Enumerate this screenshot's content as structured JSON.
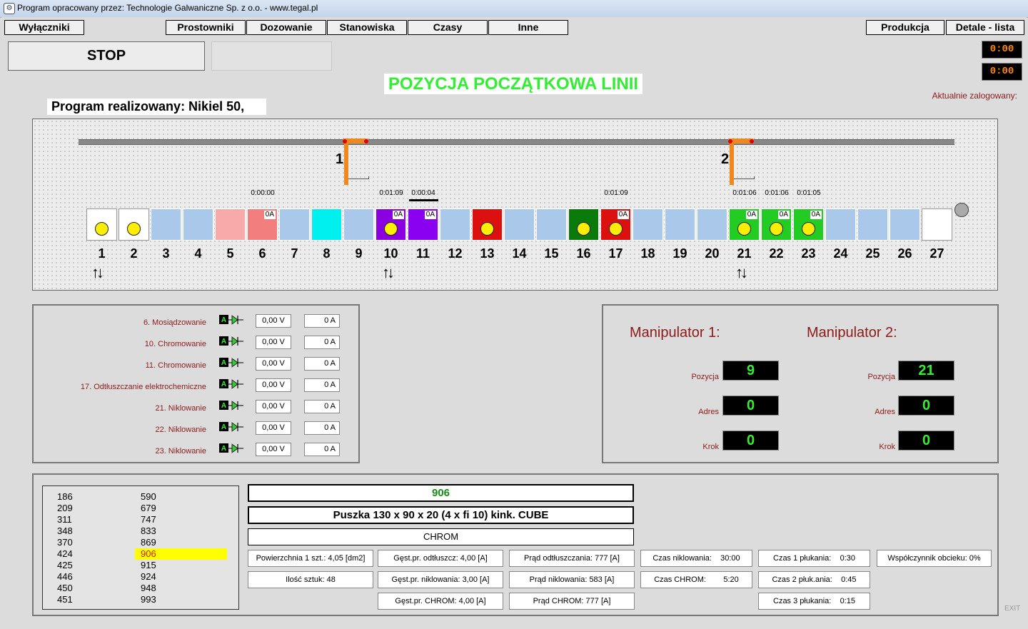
{
  "window": {
    "title": "Program opracowany przez: Technologie Galwaniczne Sp. z o.o. - www.tegal.pl"
  },
  "toolbar": {
    "wylaczniki": "Wyłączniki",
    "prostowniki": "Prostowniki",
    "dozowanie": "Dozowanie",
    "stanowiska": "Stanowiska",
    "czasy": "Czasy",
    "inne": "Inne",
    "produkcja": "Produkcja",
    "detale": "Detale - lista"
  },
  "status": {
    "stop": "STOP",
    "clock1": "0:00",
    "clock2": "0:00",
    "position_label": "POZYCJA POCZĄTKOWA LINII",
    "logged_in": "Aktualnie zalogowany:",
    "program": "Program realizowany: Nikiel 50,"
  },
  "line": {
    "crane1": "1",
    "crane2": "2",
    "tanks": [
      {
        "num": "1",
        "color": "#ffffff",
        "ball": true,
        "amp": "",
        "time": ""
      },
      {
        "num": "2",
        "color": "#ffffff",
        "ball": true,
        "amp": "",
        "time": ""
      },
      {
        "num": "3",
        "color": "#aac8ea",
        "ball": false,
        "amp": "",
        "time": ""
      },
      {
        "num": "4",
        "color": "#aac8ea",
        "ball": false,
        "amp": "",
        "time": ""
      },
      {
        "num": "5",
        "color": "#f8aaaa",
        "ball": false,
        "amp": "",
        "time": ""
      },
      {
        "num": "6",
        "color": "#f27e7e",
        "ball": false,
        "amp": "0A",
        "time": "0:00:00"
      },
      {
        "num": "7",
        "color": "#aac8ea",
        "ball": false,
        "amp": "",
        "time": ""
      },
      {
        "num": "8",
        "color": "#00f0f0",
        "ball": false,
        "amp": "",
        "time": ""
      },
      {
        "num": "9",
        "color": "#aac8ea",
        "ball": false,
        "amp": "",
        "time": ""
      },
      {
        "num": "10",
        "color": "#8a00e0",
        "ball": true,
        "amp": "0A",
        "time": "0:01:09"
      },
      {
        "num": "11",
        "color": "#8a00f0",
        "ball": false,
        "amp": "0A",
        "time": "0:00:04"
      },
      {
        "num": "12",
        "color": "#aac8ea",
        "ball": false,
        "amp": "",
        "time": ""
      },
      {
        "num": "13",
        "color": "#dd1010",
        "ball": true,
        "amp": "",
        "time": ""
      },
      {
        "num": "14",
        "color": "#aac8ea",
        "ball": false,
        "amp": "",
        "time": ""
      },
      {
        "num": "15",
        "color": "#aac8ea",
        "ball": false,
        "amp": "",
        "time": ""
      },
      {
        "num": "16",
        "color": "#0a7a0a",
        "ball": true,
        "amp": "",
        "time": ""
      },
      {
        "num": "17",
        "color": "#dd1010",
        "ball": true,
        "amp": "0A",
        "time": "0:01:09"
      },
      {
        "num": "18",
        "color": "#aac8ea",
        "ball": false,
        "amp": "",
        "time": ""
      },
      {
        "num": "19",
        "color": "#aac8ea",
        "ball": false,
        "amp": "",
        "time": ""
      },
      {
        "num": "20",
        "color": "#aac8ea",
        "ball": false,
        "amp": "",
        "time": ""
      },
      {
        "num": "21",
        "color": "#22cc22",
        "ball": true,
        "amp": "0A",
        "time": "0:01:06"
      },
      {
        "num": "22",
        "color": "#22cc22",
        "ball": true,
        "amp": "0A",
        "time": "0:01:06"
      },
      {
        "num": "23",
        "color": "#22cc22",
        "ball": true,
        "amp": "0A",
        "time": "0:01:05"
      },
      {
        "num": "24",
        "color": "#aac8ea",
        "ball": false,
        "amp": "",
        "time": ""
      },
      {
        "num": "25",
        "color": "#aac8ea",
        "ball": false,
        "amp": "",
        "time": ""
      },
      {
        "num": "26",
        "color": "#aac8ea",
        "ball": false,
        "amp": "",
        "time": ""
      },
      {
        "num": "27",
        "color": "#ffffff",
        "ball": false,
        "amp": "",
        "time": ""
      }
    ]
  },
  "rectifiers": [
    {
      "label": "6. Mosiądzowanie",
      "voltage": "0,00 V",
      "current": "0 A"
    },
    {
      "label": "10. Chromowanie",
      "voltage": "0,00 V",
      "current": "0 A"
    },
    {
      "label": "11. Chromowanie",
      "voltage": "0,00 V",
      "current": "0 A"
    },
    {
      "label": "17. Odtłuszczanie elektrochemiczne",
      "voltage": "0,00 V",
      "current": "0 A"
    },
    {
      "label": "21. Niklowanie",
      "voltage": "0,00 V",
      "current": "0 A"
    },
    {
      "label": "22. Niklowanie",
      "voltage": "0,00 V",
      "current": "0 A"
    },
    {
      "label": "23. Niklowanie",
      "voltage": "0,00 V",
      "current": "0 A"
    }
  ],
  "manipulators": {
    "m1": {
      "title": "Manipulator 1:",
      "pozycja_label": "Pozycja",
      "pozycja": "9",
      "adres_label": "Adres",
      "adres": "0",
      "krok_label": "Krok",
      "krok": "0"
    },
    "m2": {
      "title": "Manipulator 2:",
      "pozycja_label": "Pozycja",
      "pozycja": "21",
      "adres_label": "Adres",
      "adres": "0",
      "krok_label": "Krok",
      "krok": "0"
    }
  },
  "detail_list": {
    "col1": [
      "186",
      "209",
      "311",
      "348",
      "370",
      "424",
      "425",
      "446",
      "450",
      "451"
    ],
    "col2": [
      "590",
      "679",
      "747",
      "833",
      "869",
      "906",
      "915",
      "924",
      "948",
      "993"
    ],
    "selected": "906"
  },
  "detail": {
    "number": "906",
    "name": "Puszka 130 x 90 x 20 (4 x fi  10) kink. CUBE",
    "process": "CHROM",
    "powierzchnia": "Powierzchnia 1 szt.: 4,05 [dm2]",
    "ilosc": "Ilość sztuk: 48",
    "gest_odtl": "Gęst.pr. odtłuszcz: 4,00 [A]",
    "gest_nikl": "Gęst.pr. niklowania: 3,00 [A]",
    "gest_chrom": "Gęst.pr. CHROM: 4,00 [A]",
    "prad_odtl": "Prąd odtłuszczania: 777 [A]",
    "prad_nikl": "Prąd niklowania: 583 [A]",
    "prad_chrom": "Prąd CHROM: 777 [A]",
    "czas_nikl_label": "Czas niklowania:",
    "czas_nikl": "30:00",
    "czas_chrom_label": "Czas CHROM:",
    "czas_chrom": "5:20",
    "czas1_label": "Czas 1 płukania:",
    "czas1": "0:30",
    "czas2_label": "Czas 2 płuk.ania:",
    "czas2": "0:45",
    "czas3_label": "Czas 3 płukania:",
    "czas3": "0:15",
    "wspolczynnik": "Współczynnik obcieku: 0%"
  },
  "footer": {
    "exit": "EXIT"
  }
}
